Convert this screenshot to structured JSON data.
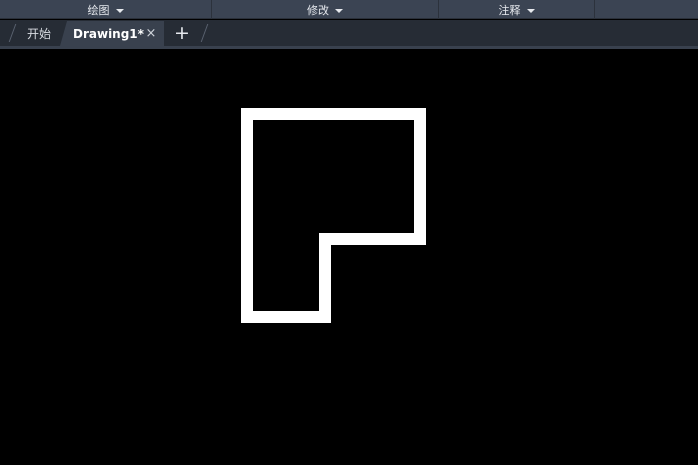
{
  "ribbon": {
    "panels": [
      {
        "label": "绘图"
      },
      {
        "label": "修改"
      },
      {
        "label": "注释"
      }
    ]
  },
  "file_tabs": {
    "start_label": "开始",
    "active_label": "Drawing1*",
    "close_glyph": "×",
    "new_glyph": "+"
  },
  "drawing": {
    "background_color": "#000000",
    "stroke_color": "#ffffff",
    "shape": "closed-polyline"
  }
}
